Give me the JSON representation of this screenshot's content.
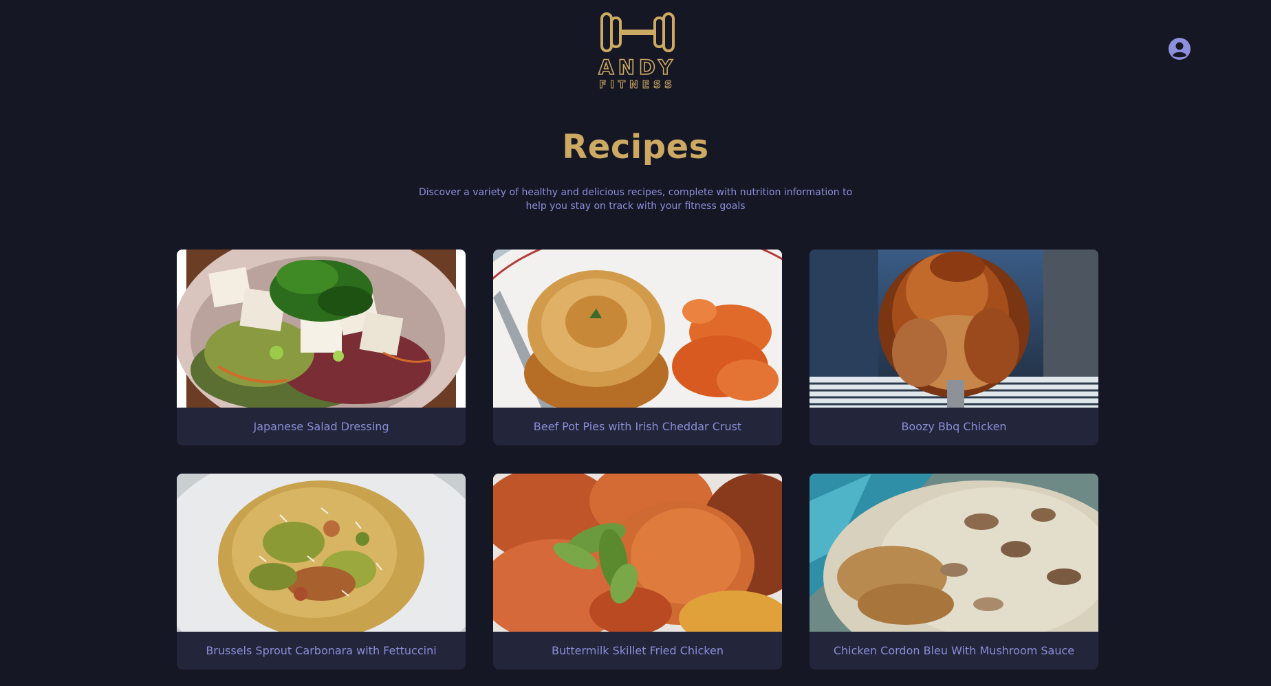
{
  "brand": {
    "line1": "ANDY",
    "line2": "FITNESS",
    "accent_color": "#cdaa63"
  },
  "header": {
    "profile_icon": "user-circle-icon"
  },
  "page": {
    "title": "Recipes",
    "subtitle": "Discover a variety of healthy and delicious recipes, complete with nutrition information to help you stay on track with your fitness goals"
  },
  "recipes": [
    {
      "name": "Japanese Salad Dressing",
      "image": "salad-photo"
    },
    {
      "name": "Beef Pot Pies with Irish Cheddar Crust",
      "image": "pot-pie-photo"
    },
    {
      "name": "Boozy Bbq Chicken",
      "image": "roast-chicken-photo"
    },
    {
      "name": "Brussels Sprout Carbonara with Fettuccini",
      "image": "pasta-photo"
    },
    {
      "name": "Buttermilk Skillet Fried Chicken",
      "image": "fried-chicken-photo"
    },
    {
      "name": "Chicken Cordon Bleu With Mushroom Sauce",
      "image": "cordon-bleu-photo"
    }
  ],
  "colors": {
    "background": "#161724",
    "card": "#23253a",
    "caption_text": "#8a8dd6",
    "subtitle_text": "#8c8fdb",
    "title_gold": "#cdaa63"
  }
}
